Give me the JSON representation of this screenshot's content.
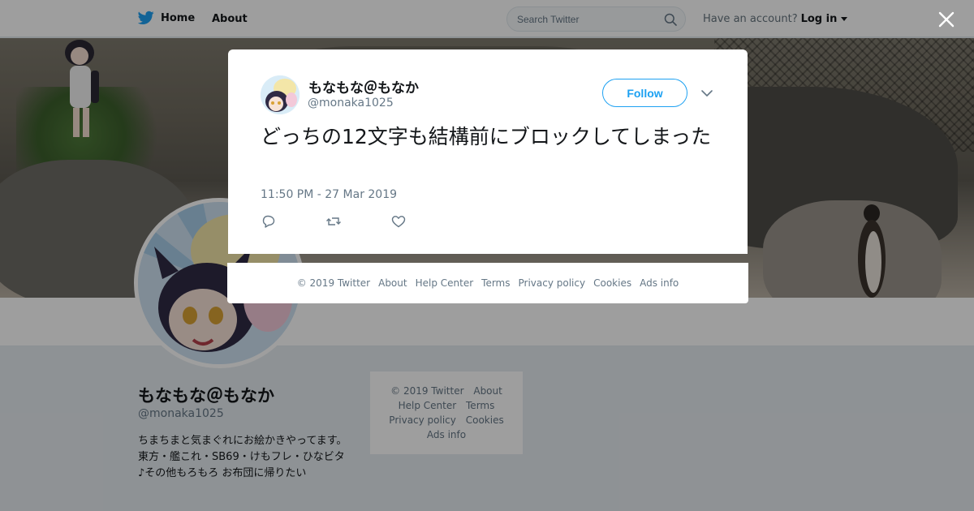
{
  "nav": {
    "home_label": "Home",
    "about_label": "About",
    "search_placeholder": "Search Twitter",
    "account_prompt": "Have an account?",
    "login_label": "Log in"
  },
  "profile": {
    "name": "もなもな＠もなか",
    "handle": "@monaka1025",
    "bio": "ちまちまと気まぐれにお絵かきやってます。東方・艦これ・SB69・けもフレ・ひなビタ♪その他もろもろ お布団に帰りたい"
  },
  "side_footer": {
    "copyright": "© 2019 Twitter",
    "about": "About",
    "help": "Help Center",
    "terms": "Terms",
    "privacy": "Privacy policy",
    "cookies": "Cookies",
    "ads": "Ads info"
  },
  "tweet": {
    "author_name": "もなもな＠もなか",
    "author_handle": "@monaka1025",
    "follow_label": "Follow",
    "text": "どっちの12文字も結構前にブロックしてしまった",
    "timestamp": "11:50 PM - 27 Mar 2019"
  },
  "modal_footer": {
    "copyright": "© 2019 Twitter",
    "about": "About",
    "help": "Help Center",
    "terms": "Terms",
    "privacy": "Privacy policy",
    "cookies": "Cookies",
    "ads": "Ads info"
  },
  "icons": {
    "brand": "twitter-bird-icon",
    "search": "search-icon",
    "close": "close-icon",
    "menu": "chevron-down-icon",
    "reply": "reply-icon",
    "retweet": "retweet-icon",
    "like": "heart-icon"
  },
  "colors": {
    "brand_blue": "#1da1f2",
    "text_primary": "#14171a",
    "text_secondary": "#657786",
    "page_background": "#e6ecf0"
  }
}
